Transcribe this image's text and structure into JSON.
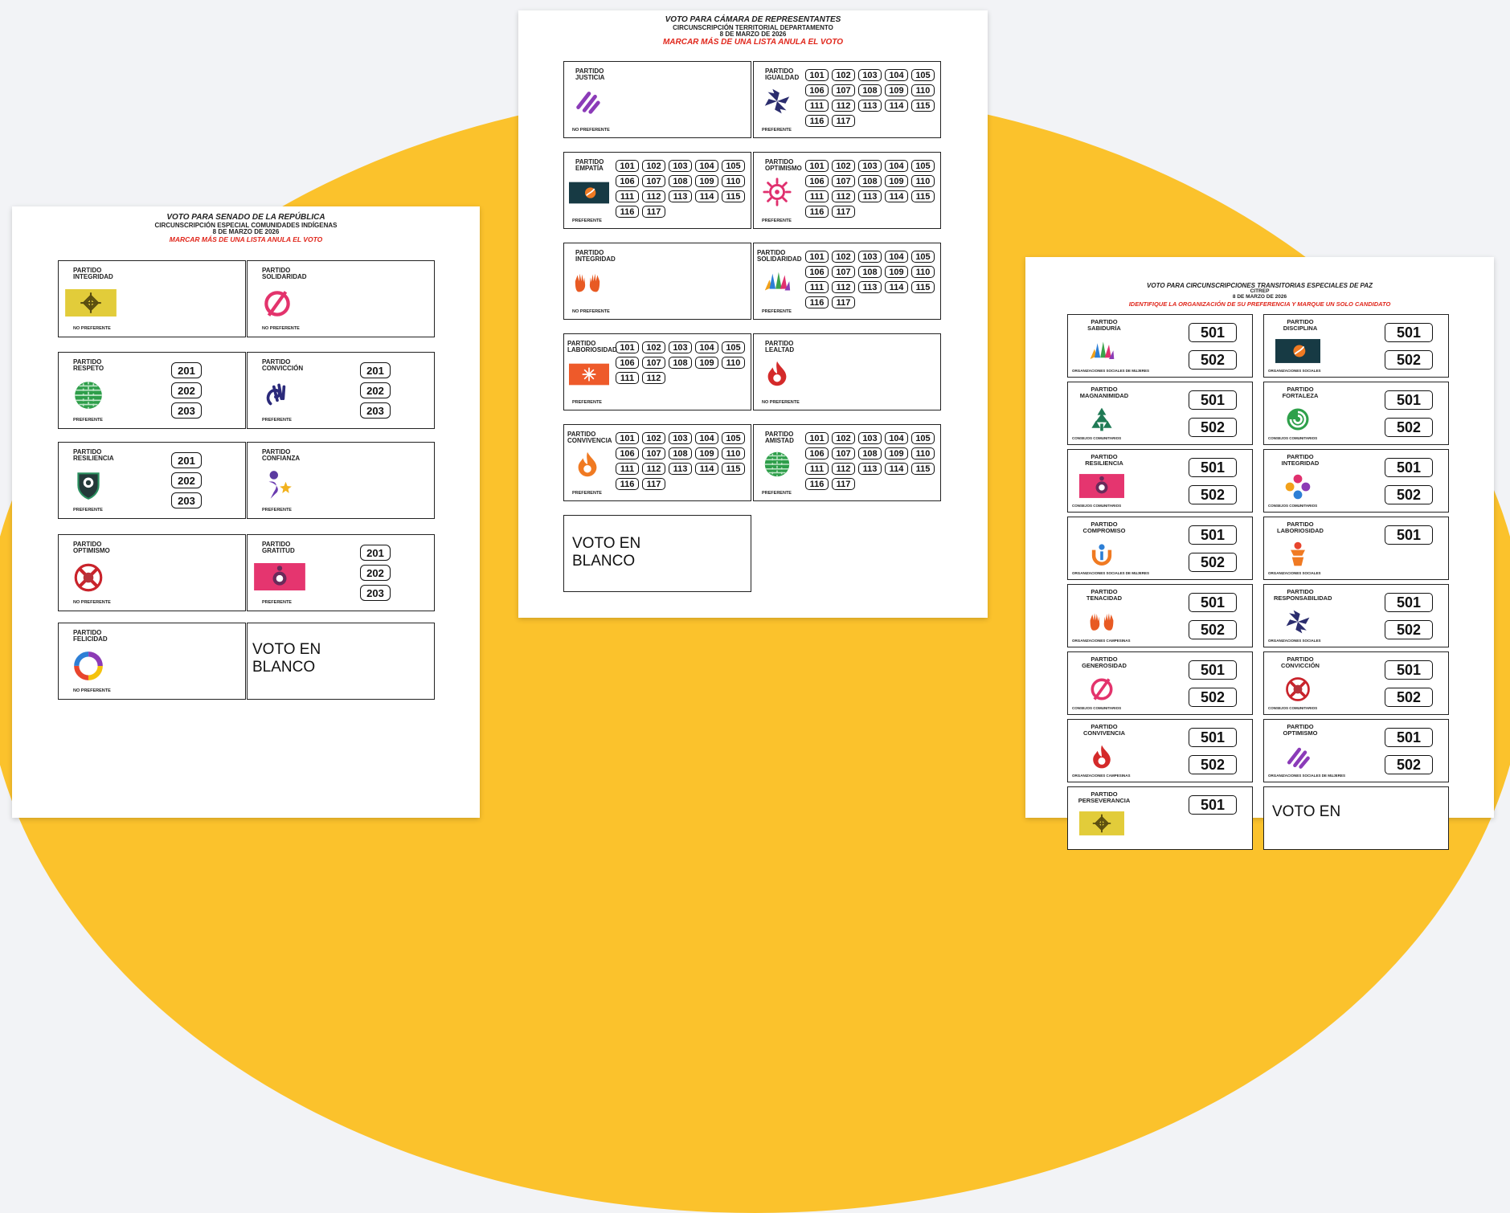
{
  "senado": {
    "title": "VOTO PARA SENADO DE LA REPÚBLICA",
    "subtitle": "CIRCUNSCRIPCIÓN ESPECIAL COMUNIDADES INDÍGENAS",
    "date": "8 DE MARZO DE 2026",
    "warning": "MARCAR MÁS DE UNA LISTA ANULA EL VOTO",
    "cards": [
      {
        "partido": "PARTIDO",
        "name": "INTEGRIDAD",
        "tag": "NO PREFERENTE",
        "logo": "knot-flag-icon",
        "nums": []
      },
      {
        "partido": "PARTIDO",
        "name": "SOLIDARIDAD",
        "tag": "NO PREFERENTE",
        "logo": "pink-null-icon",
        "nums": []
      },
      {
        "partido": "PARTIDO",
        "name": "RESPETO",
        "tag": "PREFERENTE",
        "logo": "green-globe-icon",
        "nums": [
          "201",
          "202",
          "203"
        ]
      },
      {
        "partido": "PARTIDO",
        "name": "CONVICCIÓN",
        "tag": "PREFERENTE",
        "logo": "hand-swirl-icon",
        "nums": [
          "201",
          "202",
          "203"
        ]
      },
      {
        "partido": "PARTIDO",
        "name": "RESILIENCIA",
        "tag": "PREFERENTE",
        "logo": "shield-icon",
        "nums": [
          "201",
          "202",
          "203"
        ]
      },
      {
        "partido": "PARTIDO",
        "name": "CONFIANZA",
        "tag": "PREFERENTE",
        "logo": "figure-star-icon",
        "nums": []
      },
      {
        "partido": "PARTIDO",
        "name": "OPTIMISMO",
        "tag": "NO PREFERENTE",
        "logo": "red-cross-circle-icon",
        "nums": []
      },
      {
        "partido": "PARTIDO",
        "name": "GRATITUD",
        "tag": "PREFERENTE",
        "logo": "pink-flag-icon",
        "nums": [
          "201",
          "202",
          "203"
        ]
      },
      {
        "partido": "PARTIDO",
        "name": "FELICIDAD",
        "tag": "NO PREFERENTE",
        "logo": "color-ring-icon",
        "nums": []
      }
    ],
    "blank": [
      "VOTO EN",
      "BLANCO"
    ]
  },
  "camara": {
    "title": "VOTO PARA CÁMARA DE REPRESENTANTES",
    "subtitle": "CIRCUNSCRIPCIÓN TERRITORIAL DEPARTAMENTO",
    "date": "8 DE MARZO DE 2026",
    "warning": "MARCAR MÁS DE UNA LISTA ANULA EL VOTO",
    "cards": [
      {
        "partido": "PARTIDO",
        "name": "JUSTICIA",
        "tag": "NO PREFERENTE",
        "logo": "purple-stripes-icon",
        "nums": []
      },
      {
        "partido": "PARTIDO",
        "name": "IGUALDAD",
        "tag": "PREFERENTE",
        "logo": "pinwheel-icon",
        "nums": [
          "101",
          "102",
          "103",
          "104",
          "105",
          "106",
          "107",
          "108",
          "109",
          "110",
          "111",
          "112",
          "113",
          "114",
          "115",
          "116",
          "117"
        ]
      },
      {
        "partido": "PARTIDO",
        "name": "EMPATÍA",
        "tag": "PREFERENTE",
        "logo": "dark-flag-icon",
        "nums": [
          "101",
          "102",
          "103",
          "104",
          "105",
          "106",
          "107",
          "108",
          "109",
          "110",
          "111",
          "112",
          "113",
          "114",
          "115",
          "116",
          "117"
        ]
      },
      {
        "partido": "PARTIDO",
        "name": "OPTIMISMO",
        "tag": "PREFERENTE",
        "logo": "pink-sun-icon",
        "nums": [
          "101",
          "102",
          "103",
          "104",
          "105",
          "106",
          "107",
          "108",
          "109",
          "110",
          "111",
          "112",
          "113",
          "114",
          "115",
          "116",
          "117"
        ]
      },
      {
        "partido": "PARTIDO",
        "name": "INTEGRIDAD",
        "tag": "NO PREFERENTE",
        "logo": "orange-hands-icon",
        "nums": []
      },
      {
        "partido": "PARTIDO",
        "name": "SOLIDARIDAD",
        "tag": "PREFERENTE",
        "logo": "color-hands-icon",
        "nums": [
          "101",
          "102",
          "103",
          "104",
          "105",
          "106",
          "107",
          "108",
          "109",
          "110",
          "111",
          "112",
          "113",
          "114",
          "115",
          "116",
          "117"
        ]
      },
      {
        "partido": "PARTIDO",
        "name": "LABORIOSIDAD",
        "tag": "PREFERENTE",
        "logo": "orange-star-flag-icon",
        "nums": [
          "101",
          "102",
          "103",
          "104",
          "105",
          "106",
          "107",
          "108",
          "109",
          "110",
          "111",
          "112"
        ]
      },
      {
        "partido": "PARTIDO",
        "name": "LEALTAD",
        "tag": "NO PREFERENTE",
        "logo": "red-flame-icon",
        "nums": []
      },
      {
        "partido": "PARTIDO",
        "name": "CONVIVENCIA",
        "tag": "PREFERENTE",
        "logo": "orange-flame-icon",
        "nums": [
          "101",
          "102",
          "103",
          "104",
          "105",
          "106",
          "107",
          "108",
          "109",
          "110",
          "111",
          "112",
          "113",
          "114",
          "115",
          "116",
          "117"
        ]
      },
      {
        "partido": "PARTIDO",
        "name": "AMISTAD",
        "tag": "PREFERENTE",
        "logo": "green-globe-icon",
        "nums": [
          "101",
          "102",
          "103",
          "104",
          "105",
          "106",
          "107",
          "108",
          "109",
          "110",
          "111",
          "112",
          "113",
          "114",
          "115",
          "116",
          "117"
        ]
      }
    ],
    "blank": [
      "VOTO EN",
      "BLANCO"
    ]
  },
  "citrep": {
    "title": "VOTO PARA CIRCUNSCRIPCIONES TRANSITORIAS ESPECIALES DE PAZ",
    "subtitle": "CITREP",
    "date": "8 DE MARZO DE 2026",
    "warning": "IDENTIFIQUE LA ORGANIZACIÓN DE SU PREFERENCIA Y MARQUE UN SOLO CANDIDATO",
    "cards": [
      {
        "partido": "PARTIDO",
        "name": "SABIDURÍA",
        "tag": "ORGANIZACIONES SOCIALES DE MUJERES",
        "logo": "color-hands-icon",
        "nums": [
          "501",
          "502"
        ]
      },
      {
        "partido": "PARTIDO",
        "name": "DISCIPLINA",
        "tag": "ORGANIZACIONES SOCIALES",
        "logo": "dark-flag-icon",
        "nums": [
          "501",
          "502"
        ]
      },
      {
        "partido": "PARTIDO",
        "name": "MAGNANIMIDAD",
        "tag": "CONSEJOS COMUNITARIOS",
        "logo": "green-tree-icon",
        "nums": [
          "501",
          "502"
        ]
      },
      {
        "partido": "PARTIDO",
        "name": "FORTALEZA",
        "tag": "CONSEJOS COMUNITARIOS",
        "logo": "green-spiral-icon",
        "nums": [
          "501",
          "502"
        ]
      },
      {
        "partido": "PARTIDO",
        "name": "RESILIENCIA",
        "tag": "CONSEJOS COMUNITARIOS",
        "logo": "pink-flag-icon",
        "nums": [
          "501",
          "502"
        ]
      },
      {
        "partido": "PARTIDO",
        "name": "INTEGRIDAD",
        "tag": "CONSEJOS COMUNITARIOS",
        "logo": "color-flower-icon",
        "nums": [
          "501",
          "502"
        ]
      },
      {
        "partido": "PARTIDO",
        "name": "COMPROMISO",
        "tag": "ORGANIZACIONES SOCIALES DE MUJERES",
        "logo": "orange-u-icon",
        "nums": [
          "501",
          "502"
        ]
      },
      {
        "partido": "PARTIDO",
        "name": "LABORIOSIDAD",
        "tag": "ORGANIZACIONES SOCIALES",
        "logo": "orange-figure-icon",
        "nums": [
          "501"
        ]
      },
      {
        "partido": "PARTIDO",
        "name": "TENACIDAD",
        "tag": "ORGANIZACIONES CAMPESINAS",
        "logo": "orange-hands-icon",
        "nums": [
          "501",
          "502"
        ]
      },
      {
        "partido": "PARTIDO",
        "name": "RESPONSABILIDAD",
        "tag": "ORGANIZACIONES SOCIALES",
        "logo": "pinwheel-icon",
        "nums": [
          "501",
          "502"
        ]
      },
      {
        "partido": "PARTIDO",
        "name": "GENEROSIDAD",
        "tag": "CONSEJOS COMUNITARIOS",
        "logo": "pink-null-icon",
        "nums": [
          "501",
          "502"
        ]
      },
      {
        "partido": "PARTIDO",
        "name": "CONVICCIÓN",
        "tag": "CONSEJOS COMUNITARIOS",
        "logo": "red-cross-circle-icon",
        "nums": [
          "501",
          "502"
        ]
      },
      {
        "partido": "PARTIDO",
        "name": "CONVIVENCIA",
        "tag": "ORGANIZACIONES CAMPESINAS",
        "logo": "red-flame-icon",
        "nums": [
          "501",
          "502"
        ]
      },
      {
        "partido": "PARTIDO",
        "name": "OPTIMISMO",
        "tag": "ORGANIZACIONES SOCIALES DE MUJERES",
        "logo": "purple-stripes-icon",
        "nums": [
          "501",
          "502"
        ]
      },
      {
        "partido": "PARTIDO",
        "name": "PERSEVERANCIA",
        "tag": "",
        "logo": "knot-flag-icon",
        "nums": [
          "501"
        ]
      }
    ],
    "blank": [
      "VOTO EN",
      ""
    ]
  }
}
